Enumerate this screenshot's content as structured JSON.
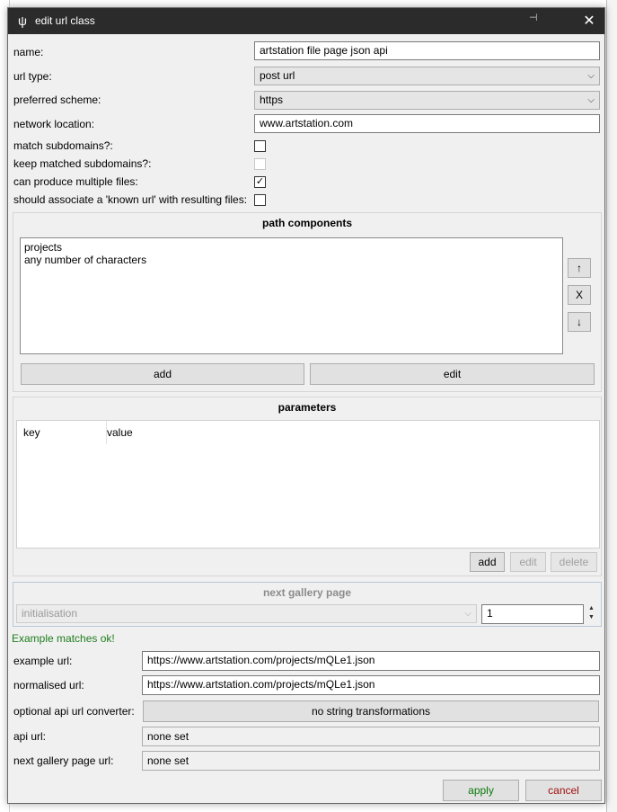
{
  "window": {
    "title": "edit url class",
    "close_glyph": "✕"
  },
  "fields": {
    "name_label": "name:",
    "name_value": "artstation file page json api",
    "url_type_label": "url type:",
    "url_type_value": "post url",
    "scheme_label": "preferred scheme:",
    "scheme_value": "https",
    "network_label": "network location:",
    "network_value": "www.artstation.com",
    "match_subdomains_label": "match subdomains?:",
    "keep_subdomains_label": "keep matched subdomains?:",
    "multiple_files_label": "can produce multiple files:",
    "known_url_label": "should associate a 'known url' with resulting files:"
  },
  "checks": {
    "multiple_files": "✓"
  },
  "path": {
    "title": "path components",
    "items": [
      "projects",
      "any number of characters"
    ],
    "up": "↑",
    "remove": "X",
    "down": "↓",
    "add": "add",
    "edit": "edit"
  },
  "params": {
    "title": "parameters",
    "col_key": "key",
    "col_value": "value",
    "add": "add",
    "edit": "edit",
    "delete": "delete"
  },
  "gallery": {
    "title": "next gallery page",
    "type_value": "initialisation",
    "spin_value": "1"
  },
  "example": {
    "status": "Example matches ok!",
    "status_color": "#1e7d1e",
    "example_label": "example url:",
    "example_value": "https://www.artstation.com/projects/mQLe1.json",
    "normalised_label": "normalised url:",
    "normalised_value": "https://www.artstation.com/projects/mQLe1.json",
    "converter_label": "optional api url converter:",
    "converter_value": "no string transformations",
    "api_label": "api url:",
    "api_value": "none set",
    "next_label": "next gallery page url:",
    "next_value": "none set"
  },
  "footer": {
    "apply": "apply",
    "apply_color": "#0a7a0a",
    "cancel": "cancel",
    "cancel_color": "#a01010"
  }
}
